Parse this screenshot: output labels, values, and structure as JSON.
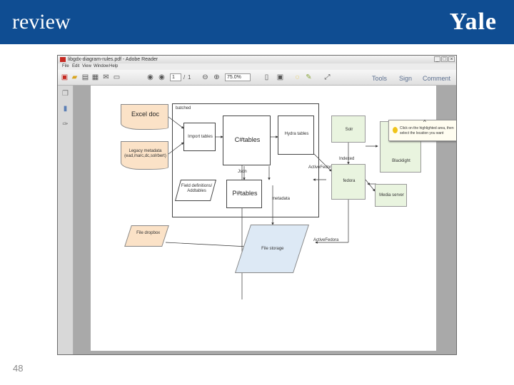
{
  "slide": {
    "title": "review",
    "logo": "Yale",
    "page_number": "48"
  },
  "window": {
    "title": "libgdx-diagram-rules.pdf - Adobe Reader",
    "minimize": "_",
    "maximize": "□",
    "close": "×"
  },
  "menu": {
    "items": [
      "File",
      "Edit",
      "View",
      "Window",
      "Help"
    ]
  },
  "toolbar": {
    "page_current": "1",
    "page_sep": "/",
    "page_total": "1",
    "zoom": "75.0%",
    "tools_label": "Tools",
    "sign_label": "Sign",
    "comment_label": "Comment"
  },
  "tooltip": {
    "close": "^",
    "text": "Click on the highlighted area, then select the location you want"
  },
  "diagram": {
    "excel_doc": "Excel doc",
    "legacy_metadata": "Legacy metadata (ead,marc,dc,solrbert)",
    "batched": "batched",
    "import_tables": "Import tables",
    "c_tables": "C#tables",
    "hydra_tables": "Hydra tables",
    "json": "Json",
    "p_tables": "P#tables",
    "field_definitions": "Field definitions/ Addtables",
    "solr": "Solr",
    "blacklight": "Blacklight",
    "fedora": "fedora",
    "indexed": "Indexed",
    "active_fedora_1": "ActiveFedora",
    "media_server": "Media server",
    "file_dropbox": "File dropbox",
    "file_storage": "File storage",
    "active_fedora_2": "ActiveFedora",
    "metadata": "metadata"
  }
}
